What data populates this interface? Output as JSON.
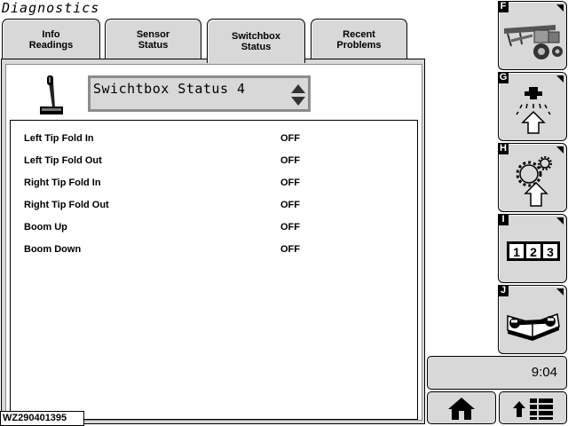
{
  "header": {
    "title": "Diagnostics"
  },
  "tabs": [
    {
      "line1": "Info",
      "line2": "Readings",
      "active": false
    },
    {
      "line1": "Sensor",
      "line2": "Status",
      "active": false
    },
    {
      "line1": "Switchbox",
      "line2": "Status",
      "active": true
    },
    {
      "line1": "Recent",
      "line2": "Problems",
      "active": false
    }
  ],
  "status_select": {
    "value": "Swichtbox Status 4"
  },
  "rows": [
    {
      "label": "Left Tip Fold In",
      "value": "OFF"
    },
    {
      "label": "Left Tip Fold Out",
      "value": "OFF"
    },
    {
      "label": "Right Tip Fold In",
      "value": "OFF"
    },
    {
      "label": "Right Tip Fold Out",
      "value": "OFF"
    },
    {
      "label": "Boom Up",
      "value": "OFF"
    },
    {
      "label": "Boom Down",
      "value": "OFF"
    }
  ],
  "side_buttons": [
    {
      "letter": "F",
      "icon": "sprayer-machine-icon"
    },
    {
      "letter": "G",
      "icon": "nozzle-spray-icon"
    },
    {
      "letter": "H",
      "icon": "gears-icon"
    },
    {
      "letter": "I",
      "icon": "number-display-icon",
      "digits": [
        "1",
        "2",
        "3"
      ]
    },
    {
      "letter": "J",
      "icon": "wrench-book-icon"
    }
  ],
  "clock": "9:04",
  "bottom_buttons": [
    {
      "icon": "home-icon"
    },
    {
      "icon": "menu-list-icon"
    }
  ],
  "figure_id": "WZ290401395",
  "colors": {
    "panel_gray": "#d8d8d8",
    "border": "#000000",
    "select_border": "#8c8c8c"
  }
}
